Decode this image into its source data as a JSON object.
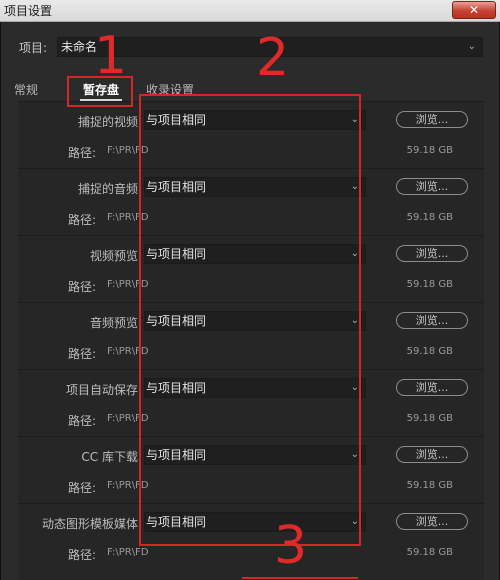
{
  "window": {
    "title": "项目设置",
    "close_label": "✕"
  },
  "project": {
    "label": "项目:",
    "value": "未命名"
  },
  "tabs": [
    {
      "label": "常规"
    },
    {
      "label": "暂存盘"
    },
    {
      "label": "收录设置"
    }
  ],
  "sections": [
    {
      "label": "捕捉的视频:",
      "value": "与项目相同",
      "browse": "浏览...",
      "path_label": "路径:",
      "path": "F:\\PR\\FD",
      "size": "59.18 GB"
    },
    {
      "label": "捕捉的音频:",
      "value": "与项目相同",
      "browse": "浏览...",
      "path_label": "路径:",
      "path": "F:\\PR\\FD",
      "size": "59.18 GB"
    },
    {
      "label": "视频预览:",
      "value": "与项目相同",
      "browse": "浏览...",
      "path_label": "路径:",
      "path": "F:\\PR\\FD",
      "size": "59.18 GB"
    },
    {
      "label": "音频预览:",
      "value": "与项目相同",
      "browse": "浏览...",
      "path_label": "路径:",
      "path": "F:\\PR\\FD",
      "size": "59.18 GB"
    },
    {
      "label": "项目自动保存:",
      "value": "与项目相同",
      "browse": "浏览...",
      "path_label": "路径:",
      "path": "F:\\PR\\FD",
      "size": "59.18 GB"
    },
    {
      "label": "CC 库下载:",
      "value": "与项目相同",
      "browse": "浏览...",
      "path_label": "路径:",
      "path": "F:\\PR\\FD",
      "size": "59.18 GB"
    },
    {
      "label": "动态图形模板媒体:",
      "value": "与项目相同",
      "browse": "浏览...",
      "path_label": "路径:",
      "path": "F:\\PR\\FD",
      "size": "59.18 GB"
    }
  ],
  "annotations": [
    {
      "label": "1"
    },
    {
      "label": "2"
    },
    {
      "label": "3"
    }
  ],
  "colors": {
    "annotation": "#d42626",
    "dialog_bg": "#2b2b2b",
    "panel_bg": "#262626"
  },
  "icons": {
    "dropdown": "chevron-down-icon"
  }
}
